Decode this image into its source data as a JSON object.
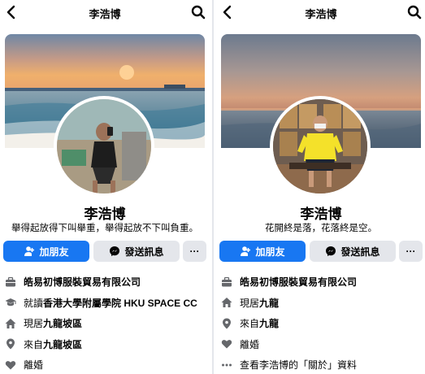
{
  "colors": {
    "accent": "#1877f2",
    "button_gray": "#e4e6eb",
    "icon_gray": "#65676b",
    "text": "#050505"
  },
  "left": {
    "header": {
      "title": "李浩博",
      "back_icon": "chevron-left-icon",
      "search_icon": "search-icon"
    },
    "name": "李浩博",
    "bio": "舉得起放得下叫舉重，舉得起放不下叫負重。",
    "buttons": {
      "add_friend": "加朋友",
      "message": "發送訊息",
      "more": "···"
    },
    "info": [
      {
        "icon": "briefcase-icon",
        "prefix": "",
        "bold": "皓易初博服裝貿易有限公司",
        "suffix": ""
      },
      {
        "icon": "graduation-cap-icon",
        "prefix": "就讀",
        "bold": "香港大學附屬學院 HKU SPACE CC",
        "suffix": ""
      },
      {
        "icon": "home-icon",
        "prefix": "現居",
        "bold": "九龍坡區",
        "suffix": ""
      },
      {
        "icon": "location-pin-icon",
        "prefix": "來自",
        "bold": "九龍坡區",
        "suffix": ""
      },
      {
        "icon": "heart-icon",
        "prefix": "離婚",
        "bold": "",
        "suffix": ""
      }
    ]
  },
  "right": {
    "header": {
      "title": "李浩博",
      "back_icon": "chevron-left-icon",
      "search_icon": "search-icon"
    },
    "name": "李浩博",
    "bio": "花開終是落，花落終是空。",
    "buttons": {
      "add_friend": "加朋友",
      "message": "發送訊息",
      "more": "···"
    },
    "info": [
      {
        "icon": "briefcase-icon",
        "prefix": "",
        "bold": "皓易初博服裝貿易有限公司",
        "suffix": ""
      },
      {
        "icon": "home-icon",
        "prefix": "現居",
        "bold": "九龍",
        "suffix": ""
      },
      {
        "icon": "location-pin-icon",
        "prefix": "來自",
        "bold": "九龍",
        "suffix": ""
      },
      {
        "icon": "heart-icon",
        "prefix": "離婚",
        "bold": "",
        "suffix": ""
      },
      {
        "icon": "more-dots-icon",
        "prefix": "查看李浩博的「關於」資料",
        "bold": "",
        "suffix": ""
      }
    ]
  }
}
